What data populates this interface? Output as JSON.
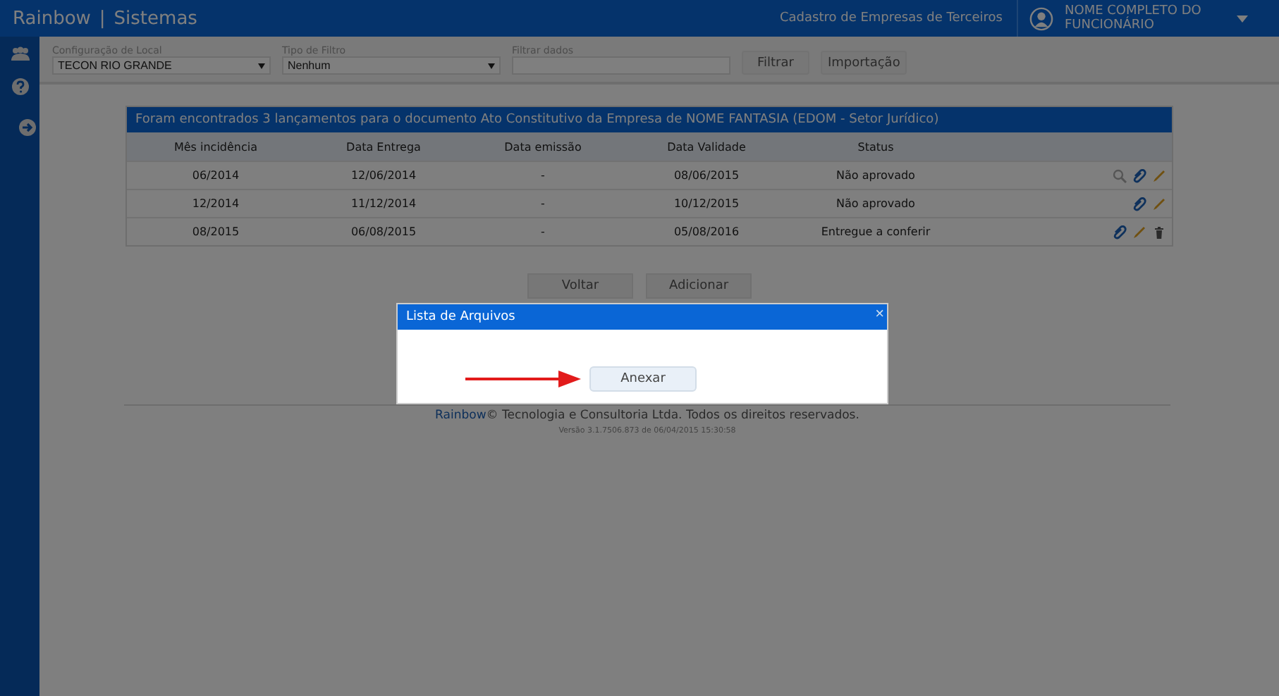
{
  "header": {
    "brand": "Rainbow",
    "separator": "|",
    "product": "Sistemas",
    "module": "Cadastro de Empresas de Terceiros",
    "user": "NOME COMPLETO DO FUNCIONÁRIO"
  },
  "filters": [
    {
      "label": "Configuração de Local",
      "value": "TECON RIO GRANDE",
      "kind": "select"
    },
    {
      "label": "Tipo de Filtro",
      "value": "Nenhum",
      "kind": "select"
    },
    {
      "label": "Filtrar dados",
      "kind": "text"
    }
  ],
  "filter_buttons": [
    "Filtrar",
    "Importação"
  ],
  "table": {
    "title": "Foram encontrados 3 lançamentos para o documento Ato Constitutivo da Empresa de NOME FANTASIA (EDOM - Setor Jurídico)",
    "columns": [
      "Mês incidência",
      "Data Entrega",
      "Data emissão",
      "Data Validade",
      "Status"
    ],
    "rows": [
      {
        "cells": [
          "06/2014",
          "12/06/2014",
          "-",
          "08/06/2015",
          "Não aprovado"
        ],
        "actions": [
          {
            "kind": "view"
          },
          {
            "kind": "attach"
          },
          {
            "kind": "edit"
          }
        ]
      },
      {
        "cells": [
          "12/2014",
          "11/12/2014",
          "-",
          "10/12/2015",
          "Não aprovado"
        ],
        "actions": [
          {
            "kind": "attach"
          },
          {
            "kind": "edit"
          }
        ]
      },
      {
        "cells": [
          "08/2015",
          "06/08/2015",
          "-",
          "05/08/2016",
          "Entregue a conferir"
        ],
        "actions": [
          {
            "kind": "attach"
          },
          {
            "kind": "edit"
          },
          {
            "kind": "delete"
          }
        ]
      }
    ]
  },
  "buttons": [
    "Voltar",
    "Adicionar"
  ],
  "footer": {
    "brand": "Rainbow",
    "text": "© Tecnologia e Consultoria Ltda. Todos os direitos reservados.",
    "version": "Versão 3.1.7506.873 de 06/04/2015 15:30:58"
  },
  "dialog": {
    "title": "Lista de Arquivos",
    "close": "×",
    "button": "Anexar"
  }
}
